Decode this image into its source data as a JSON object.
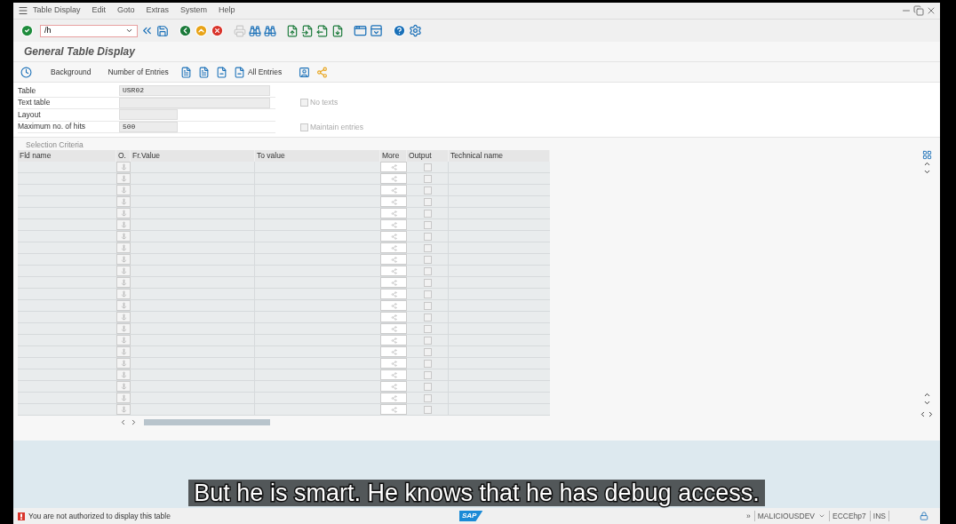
{
  "menu_bar": [
    "Table Display",
    "Edit",
    "Goto",
    "Extras",
    "System",
    "Help"
  ],
  "command_field": {
    "value": "/h"
  },
  "title": "General Table Display",
  "app_toolbar": [
    {
      "kind": "icon"
    },
    {
      "kind": "text",
      "label": "Background"
    },
    {
      "kind": "text",
      "label": "Number of Entries"
    },
    {
      "kind": "icon"
    },
    {
      "kind": "icon"
    },
    {
      "kind": "icon"
    },
    {
      "kind": "icon",
      "label": "All Entries"
    },
    {
      "kind": "icon"
    },
    {
      "kind": "icon"
    }
  ],
  "fields": [
    {
      "label": "Table",
      "value": "USR02",
      "kind": "wide"
    },
    {
      "label": "Text table",
      "kind": "wide"
    },
    {
      "label": "Layout",
      "kind": "narrow"
    },
    {
      "label": "Maximum no. of hits",
      "value": "500",
      "kind": "narrow"
    }
  ],
  "options": [
    {
      "label": "No texts",
      "checked": false,
      "disabled": true
    },
    {
      "label": "Maintain entries",
      "checked": false,
      "disabled": true
    }
  ],
  "selection": {
    "title": "Selection Criteria",
    "columns": [
      "Fld name",
      "O.",
      "Fr.Value",
      "To value",
      "More",
      "Output",
      "Technical name"
    ],
    "rows": [
      {
        "output": false
      },
      {
        "output": false
      },
      {
        "output": false
      },
      {
        "output": false
      },
      {
        "output": false
      },
      {
        "output": false
      },
      {
        "output": false
      },
      {
        "output": false
      },
      {
        "output": false
      },
      {
        "output": false
      },
      {
        "output": false
      },
      {
        "output": false
      },
      {
        "output": false
      },
      {
        "output": false
      },
      {
        "output": false
      },
      {
        "output": false
      },
      {
        "output": false
      },
      {
        "output": false
      },
      {
        "output": false
      },
      {
        "output": false
      },
      {
        "output": false
      },
      {
        "output": false
      }
    ]
  },
  "subtitle": "But he is smart. He knows that he has debug access.",
  "status_bar": {
    "kind": "error",
    "message": "You are not authorized to display this table",
    "logo": "SAP",
    "more": "»",
    "system": "MALICIOUSDEV",
    "client": "ECCEhp7",
    "mode": "INS"
  }
}
